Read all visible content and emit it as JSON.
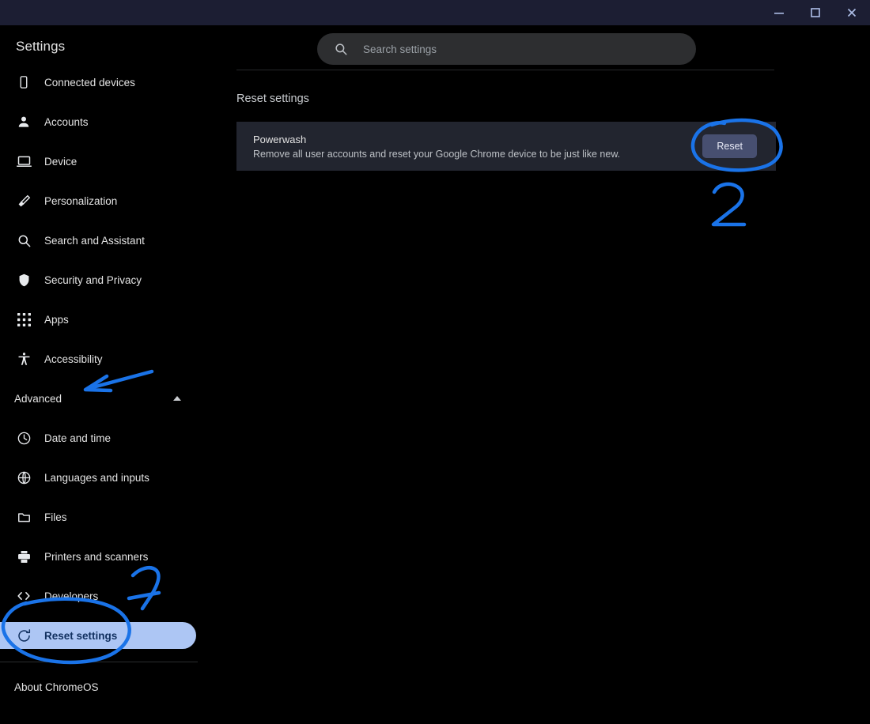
{
  "window": {
    "controls": [
      {
        "name": "minimize",
        "label": "—"
      },
      {
        "name": "maximize",
        "label": "▢"
      },
      {
        "name": "close",
        "label": "✕"
      }
    ]
  },
  "sidebar": {
    "title": "Settings",
    "items": [
      {
        "label": "Connected devices",
        "icon": "phone-icon"
      },
      {
        "label": "Accounts",
        "icon": "person-icon"
      },
      {
        "label": "Device",
        "icon": "laptop-icon"
      },
      {
        "label": "Personalization",
        "icon": "brush-icon"
      },
      {
        "label": "Search and Assistant",
        "icon": "search-icon"
      },
      {
        "label": "Security and Privacy",
        "icon": "shield-icon"
      },
      {
        "label": "Apps",
        "icon": "grid-icon"
      },
      {
        "label": "Accessibility",
        "icon": "accessibility-icon"
      }
    ],
    "advanced": {
      "label": "Advanced",
      "expanded": true,
      "chevron": "chevron-up-icon"
    },
    "advanced_items": [
      {
        "label": "Date and time",
        "icon": "clock-icon",
        "selected": false
      },
      {
        "label": "Languages and inputs",
        "icon": "globe-icon",
        "selected": false
      },
      {
        "label": "Files",
        "icon": "folder-icon",
        "selected": false
      },
      {
        "label": "Printers and scanners",
        "icon": "printer-icon",
        "selected": false
      },
      {
        "label": "Developers",
        "icon": "code-icon",
        "selected": false
      },
      {
        "label": "Reset settings",
        "icon": "restore-icon",
        "selected": true
      }
    ],
    "about": {
      "label": "About ChromeOS"
    }
  },
  "search": {
    "placeholder": "Search settings",
    "value": "",
    "icon": "search-icon"
  },
  "main": {
    "section_title": "Reset settings",
    "powerwash": {
      "title": "Powerwash",
      "description": "Remove all user accounts and reset your Google Chrome device to be just like new.",
      "button_label": "Reset"
    }
  },
  "annotations": {
    "color": "#1a73e8",
    "marks": [
      {
        "name": "arrow-to-advanced",
        "type": "arrow"
      },
      {
        "name": "step-1-numeral",
        "type": "numeral",
        "text": "1"
      },
      {
        "name": "circle-around-reset-settings",
        "type": "circle"
      },
      {
        "name": "step-2-numeral",
        "type": "numeral",
        "text": "2"
      },
      {
        "name": "circle-around-reset-button",
        "type": "circle"
      }
    ]
  },
  "colors": {
    "titlebar": "#1c1e33",
    "background": "#000000",
    "card": "#22252f",
    "selected_pill": "#adc6f4",
    "reset_button": "#474f70",
    "annotation_blue": "#1a73e8"
  }
}
